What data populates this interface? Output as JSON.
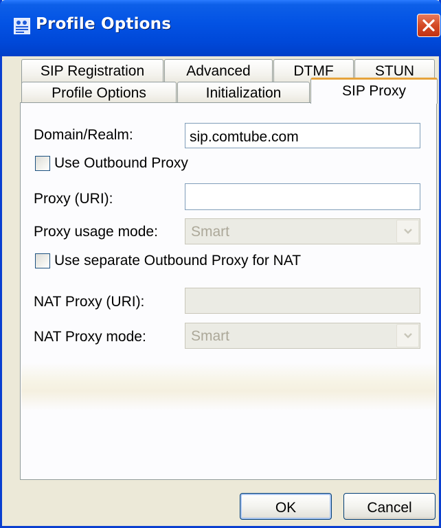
{
  "window": {
    "title": "Profile Options",
    "icon": "profile-app-icon",
    "close_icon": "close-x-icon"
  },
  "tabs": {
    "back_row": [
      "SIP Registration",
      "Advanced",
      "DTMF",
      "STUN"
    ],
    "front_row": [
      "Profile Options",
      "Initialization",
      "SIP Proxy"
    ],
    "active": "SIP Proxy"
  },
  "form": {
    "domain_label": "Domain/Realm:",
    "domain_value": "sip.comtube.com",
    "use_outbound_label": "Use Outbound Proxy",
    "use_outbound_checked": false,
    "proxy_uri_label": "Proxy (URI):",
    "proxy_uri_value": "",
    "proxy_mode_label": "Proxy usage mode:",
    "proxy_mode_value": "Smart",
    "use_nat_proxy_label": "Use separate Outbound Proxy for NAT",
    "use_nat_proxy_checked": false,
    "nat_proxy_label": "NAT Proxy (URI):",
    "nat_proxy_value": "",
    "nat_proxy_mode_label": "NAT Proxy mode:",
    "nat_proxy_mode_value": "Smart"
  },
  "buttons": {
    "ok": "OK",
    "cancel": "Cancel"
  },
  "colors": {
    "titlebar": "#0353e4",
    "window_bg": "#ece9d8",
    "active_tab_accent": "#e6a33a",
    "close_button": "#d44a25"
  }
}
